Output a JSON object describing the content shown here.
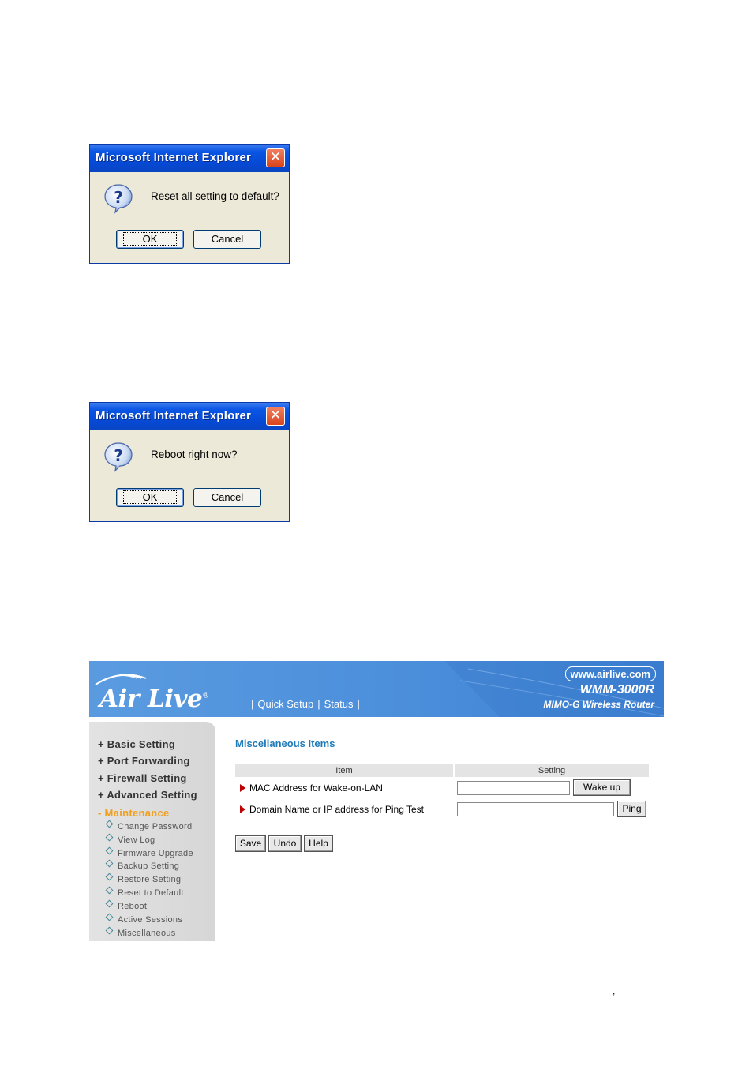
{
  "dialog_reset": {
    "title": "Microsoft Internet Explorer",
    "close_glyph": "✕",
    "message": "Reset all setting to default?",
    "ok_label": "OK",
    "cancel_label": "Cancel",
    "icon": "question-icon"
  },
  "dialog_reboot": {
    "title": "Microsoft Internet Explorer",
    "close_glyph": "✕",
    "message": "Reboot right now?",
    "ok_label": "OK",
    "cancel_label": "Cancel",
    "icon": "question-icon"
  },
  "router": {
    "header": {
      "logo": "Air Live",
      "logo_mark": "®",
      "nav": [
        "Quick Setup",
        "Status"
      ],
      "separator": "|",
      "url": "www.airlive.com",
      "model": "WMM-3000R",
      "subtitle": "MIMO-G Wireless Router"
    },
    "sidebar": {
      "menu": [
        "+ Basic Setting",
        "+ Port Forwarding",
        "+ Firewall Setting",
        "+ Advanced Setting",
        "- Maintenance"
      ],
      "submenu": [
        "Change Password",
        "View Log",
        "Firmware Upgrade",
        "Backup Setting",
        "Restore Setting",
        "Reset to Default",
        "Reboot",
        "Active Sessions",
        "Miscellaneous"
      ]
    },
    "main": {
      "title": "Miscellaneous Items",
      "col_item": "Item",
      "col_setting": "Setting",
      "rows": [
        {
          "label": "MAC Address for Wake-on-LAN",
          "value": "",
          "button": "Wake up"
        },
        {
          "label": "Domain Name or IP address for Ping Test",
          "value": "",
          "button": "Ping"
        }
      ],
      "save_label": "Save",
      "undo_label": "Undo",
      "help_label": "Help"
    },
    "colors": {
      "header_blue": "#4a8dda",
      "title_blue": "#1f7ab8",
      "active_orange": "#f0a020"
    }
  },
  "footer_mark": ","
}
